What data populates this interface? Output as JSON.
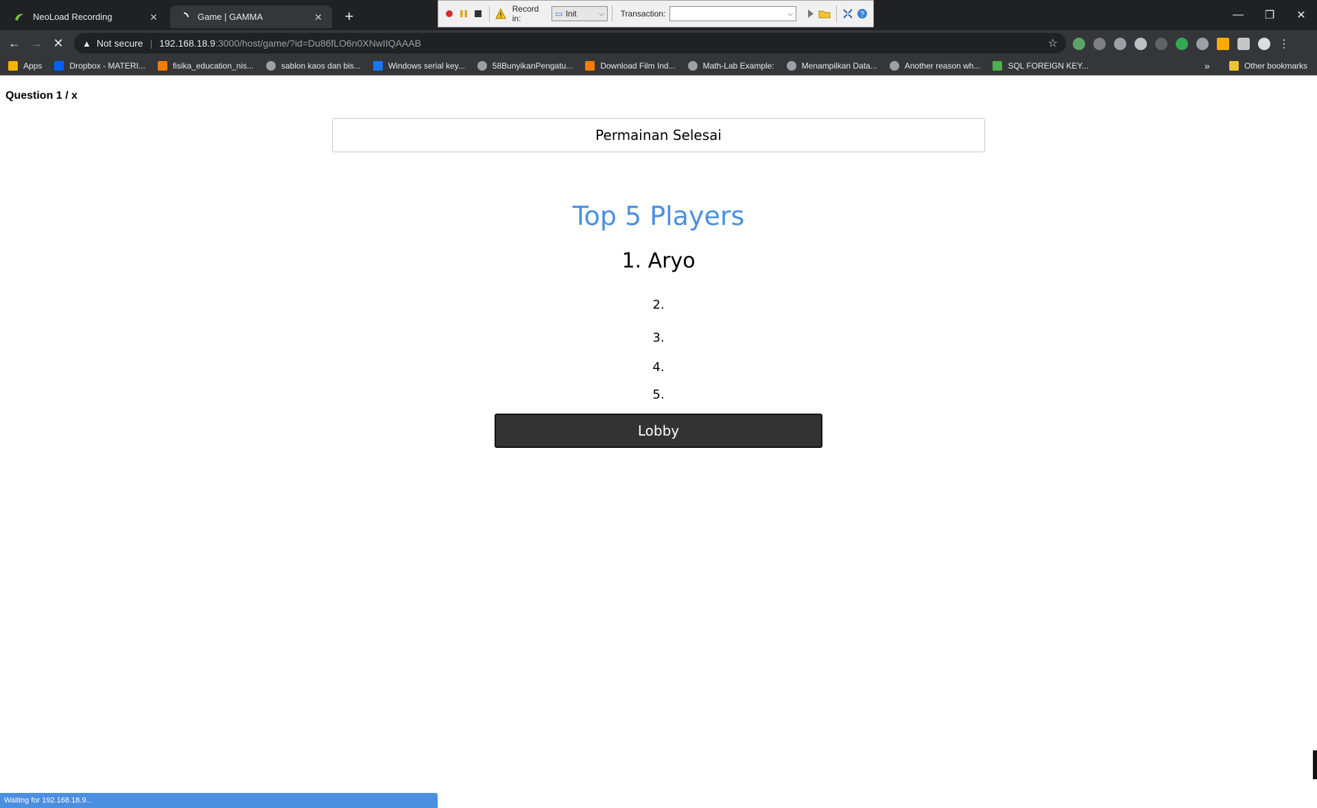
{
  "browser": {
    "tabs": [
      {
        "title": "NeoLoad Recording",
        "icon": "neoload-icon",
        "active": false
      },
      {
        "title": "Game | GAMMA",
        "icon": "loading-icon",
        "active": true
      }
    ],
    "neoload_toolbar": {
      "record_in_label": "Record in:",
      "record_in_value": "Init",
      "transaction_label": "Transaction:",
      "transaction_value": ""
    },
    "address": {
      "security_label": "Not secure",
      "host": "192.168.18.9",
      "path": ":3000/host/game/?id=Du86fLO6n0XNwIIQAAAB"
    },
    "bookmarks": [
      {
        "label": "Apps",
        "icon": "apps-grid-icon",
        "color": "#f4b400"
      },
      {
        "label": "Dropbox - MATERI...",
        "icon": "dropbox-icon",
        "color": "#0061ff"
      },
      {
        "label": "fisika_education_nis...",
        "icon": "blogger-icon",
        "color": "#f57d00"
      },
      {
        "label": "sablon kaos dan bis...",
        "icon": "globe-icon",
        "color": "#9aa0a6"
      },
      {
        "label": "Windows serial key...",
        "icon": "facebook-icon",
        "color": "#1877f2"
      },
      {
        "label": "58BunyikanPengatu...",
        "icon": "globe-icon",
        "color": "#9aa0a6"
      },
      {
        "label": "Download Film Ind...",
        "icon": "blogger-icon",
        "color": "#f57d00"
      },
      {
        "label": "Math-Lab Example:",
        "icon": "globe-icon",
        "color": "#9aa0a6"
      },
      {
        "label": "Menampilkan Data...",
        "icon": "globe-icon",
        "color": "#9aa0a6"
      },
      {
        "label": "Another reason wh...",
        "icon": "globe-icon",
        "color": "#9aa0a6"
      },
      {
        "label": "SQL FOREIGN KEY...",
        "icon": "w3schools-icon",
        "color": "#4caf50"
      }
    ],
    "other_bookmarks": "Other bookmarks",
    "status_text": "Waiting for 192.168.18.9..."
  },
  "game": {
    "question_counter": "Question 1 / x",
    "status": "Permainan Selesai",
    "leaderboard_title": "Top 5 Players",
    "ranks": [
      "1. Aryo",
      "2.",
      "3.",
      "4.",
      "5."
    ],
    "lobby_button": "Lobby"
  },
  "colors": {
    "accent_blue": "#4a90e2",
    "button_dark": "#333333",
    "chrome_dark": "#202124"
  }
}
